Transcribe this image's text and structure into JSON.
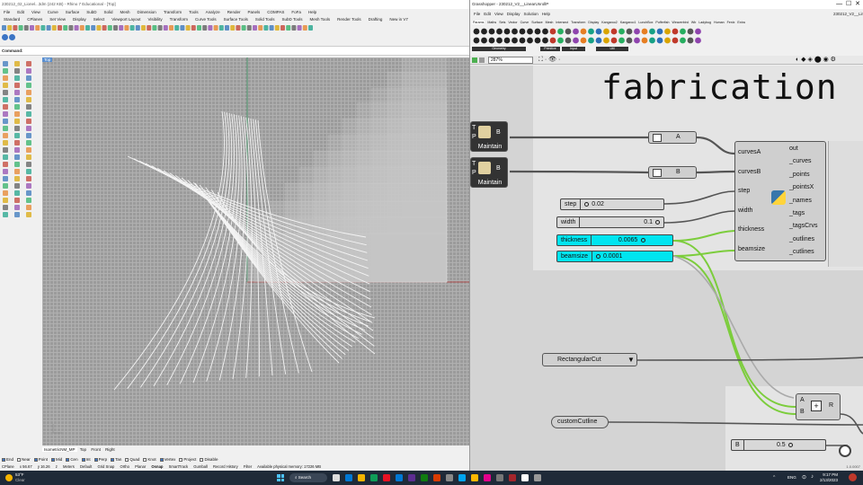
{
  "rhino": {
    "title": "230212_02_Lionel...3dm (242 KB) - Rhino 7 Educational - [Top]",
    "menu": [
      "File",
      "Edit",
      "View",
      "Curve",
      "Surface",
      "SubD",
      "Solid",
      "Mesh",
      "Dimension",
      "Transform",
      "Tools",
      "Analyze",
      "Render",
      "Panels",
      "COMPAS",
      "FoFa",
      "Help"
    ],
    "tabs": [
      "Standard",
      "CPlanes",
      "Set View",
      "Display",
      "Select",
      "Viewport Layout",
      "Visibility",
      "Transform",
      "Curve Tools",
      "Surface Tools",
      "Solid Tools",
      "SubD Tools",
      "Mesh Tools",
      "Render Tools",
      "Drafting",
      "New in V7"
    ],
    "command_label": "Command:",
    "viewport_title": "Top",
    "viewport_tabs": [
      "IsometricNM_MP",
      "Top",
      "Front",
      "Right"
    ],
    "osnaps": [
      {
        "label": "End",
        "checked": true
      },
      {
        "label": "Near",
        "checked": false
      },
      {
        "label": "Point",
        "checked": true
      },
      {
        "label": "Mid",
        "checked": true
      },
      {
        "label": "Cen",
        "checked": true
      },
      {
        "label": "Int",
        "checked": true
      },
      {
        "label": "Perp",
        "checked": true
      },
      {
        "label": "Tan",
        "checked": true
      },
      {
        "label": "Quad",
        "checked": false
      },
      {
        "label": "Knot",
        "checked": false
      },
      {
        "label": "Vertex",
        "checked": true
      },
      {
        "label": "Project",
        "checked": false
      },
      {
        "label": "Disable",
        "checked": false
      }
    ],
    "status": {
      "cplane": "CPlane",
      "x": "x 56.67",
      "y": "y 16.26",
      "z": "z",
      "units": "Meters",
      "layer": "Default",
      "toggles": [
        "Grid Snap",
        "Ortho",
        "Planar",
        "Osnap",
        "SmartTrack",
        "Gumball",
        "Record History",
        "Filter"
      ],
      "memory": "Available physical memory: 17226 MB"
    }
  },
  "gh": {
    "title": "Grasshopper - 230212_V2__LinearUnrollP",
    "title_right": "230212_V2__LinearUnr",
    "menu": [
      "File",
      "Edit",
      "View",
      "Display",
      "Solution",
      "Help"
    ],
    "tabs": [
      "Params",
      "Maths",
      "Sets",
      "Vector",
      "Curve",
      "Surface",
      "Mesh",
      "Intersect",
      "Transform",
      "Display",
      "Kangaroo2",
      "Kangaroo1",
      "LunchBox",
      "Pufferfish",
      "Weaverbird",
      "Wb",
      "Ladybug",
      "Human",
      "Fenix",
      "Extra"
    ],
    "groups": [
      "Geometry",
      "Primitive",
      "Input",
      "Util"
    ],
    "zoom": "287%",
    "canvas_title": "fabrication",
    "maintain": "Maintain",
    "ports_tb": [
      "T",
      "P"
    ],
    "relay_a": "A",
    "relay_b": "B",
    "sliders": [
      {
        "name": "step",
        "value": "0.02"
      },
      {
        "name": "width",
        "value": "0.1"
      },
      {
        "name": "thickness",
        "value": "0.0065"
      },
      {
        "name": "beamsize",
        "value": "0.0001"
      }
    ],
    "python": {
      "inputs": [
        "curvesA",
        "curvesB",
        "step",
        "width",
        "thickness",
        "beamsize"
      ],
      "outputs": [
        "out",
        "_curves",
        "_points",
        "_pointsX",
        "_names",
        "_tags",
        "_tagsCrvs",
        "_outlines",
        "_cutlines"
      ]
    },
    "rect_cut": "RectangularCut",
    "custom_cutline": "customCutline",
    "add": {
      "a": "A",
      "b": "B",
      "r": "R"
    },
    "bottom_slider": {
      "name": "B",
      "value": "0.5"
    },
    "version": "1.0.0007"
  },
  "taskbar": {
    "weather_temp": "53°F",
    "weather_text": "Clear",
    "search": "Search",
    "lang": "ENG",
    "time": "9:17 PM",
    "date": "2/13/2023"
  },
  "colors": {
    "cyan_slider": "#00e5f0",
    "wire_green": "#7ccd3c",
    "osnap_blue": "#3b74c4"
  }
}
